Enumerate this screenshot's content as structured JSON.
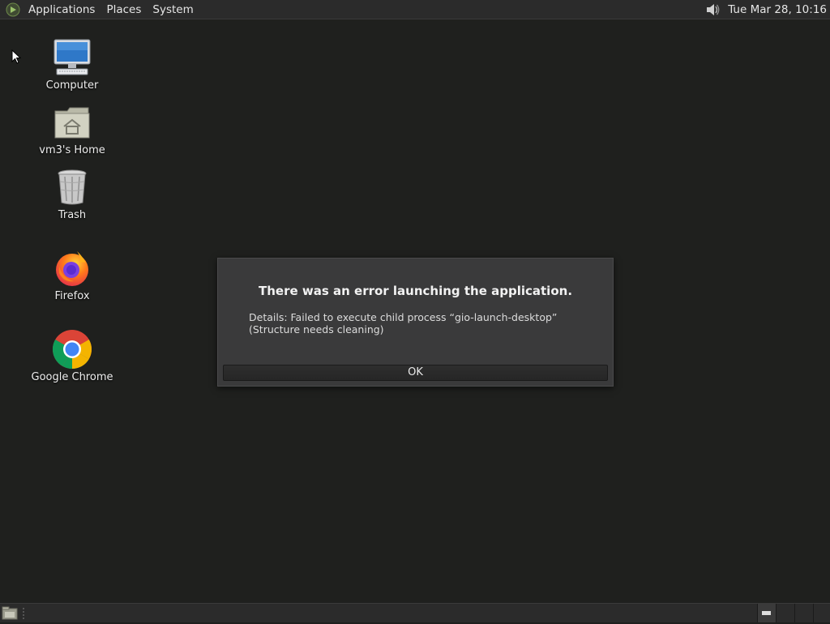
{
  "top_panel": {
    "menus": [
      "Applications",
      "Places",
      "System"
    ],
    "clock": "Tue Mar 28, 10:16",
    "logo_icon": "mate-logo-icon",
    "volume_icon": "volume-icon"
  },
  "desktop": {
    "icons": [
      {
        "label": "Computer",
        "icon": "computer-icon"
      },
      {
        "label": "vm3's Home",
        "icon": "home-folder-icon"
      },
      {
        "label": "Trash",
        "icon": "trash-icon"
      },
      {
        "label": "Firefox",
        "icon": "firefox-icon"
      },
      {
        "label": "Google Chrome",
        "icon": "chrome-icon"
      }
    ]
  },
  "dialog": {
    "title": "There was an error launching the application.",
    "details": "Details: Failed to execute child process “gio-launch-desktop” (Structure needs cleaning)",
    "ok_label": "OK"
  },
  "bottom_panel": {
    "show_desktop_icon": "show-desktop-icon",
    "workspaces": 4
  },
  "colors": {
    "desktop_bg": "#1f201e",
    "panel_bg": "#2b2b2b",
    "dialog_bg": "#3a3a3b"
  }
}
